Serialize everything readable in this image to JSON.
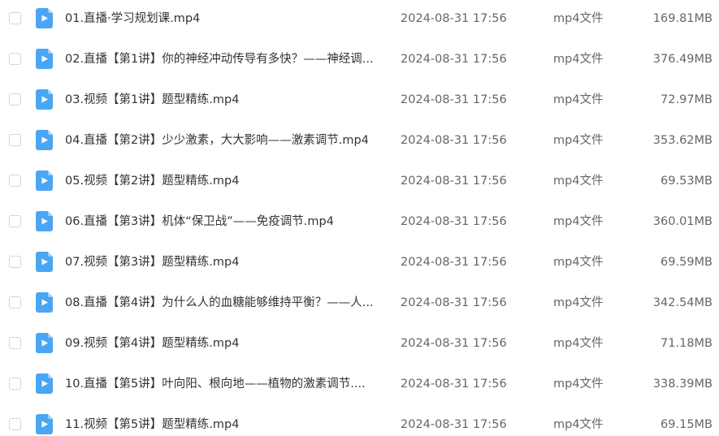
{
  "colors": {
    "icon_blue": "#4aa6f4",
    "icon_fold": "#9fd0fa",
    "checkbox_border": "#d6d6d6",
    "name_text": "#333333",
    "meta_text": "#666666"
  },
  "icon": "video-file-icon",
  "files": [
    {
      "name": "01.直播·学习规划课.mp4",
      "date": "2024-08-31 17:56",
      "type": "mp4文件",
      "size": "169.81MB"
    },
    {
      "name": "02.直播【第1讲】你的神经冲动传导有多快？——神经调...",
      "date": "2024-08-31 17:56",
      "type": "mp4文件",
      "size": "376.49MB"
    },
    {
      "name": "03.视频【第1讲】题型精练.mp4",
      "date": "2024-08-31 17:56",
      "type": "mp4文件",
      "size": "72.97MB"
    },
    {
      "name": "04.直播【第2讲】少少激素，大大影响——激素调节.mp4",
      "date": "2024-08-31 17:56",
      "type": "mp4文件",
      "size": "353.62MB"
    },
    {
      "name": "05.视频【第2讲】题型精练.mp4",
      "date": "2024-08-31 17:56",
      "type": "mp4文件",
      "size": "69.53MB"
    },
    {
      "name": "06.直播【第3讲】机体“保卫战”——免疫调节.mp4",
      "date": "2024-08-31 17:56",
      "type": "mp4文件",
      "size": "360.01MB"
    },
    {
      "name": "07.视频【第3讲】题型精练.mp4",
      "date": "2024-08-31 17:56",
      "type": "mp4文件",
      "size": "69.59MB"
    },
    {
      "name": "08.直播【第4讲】为什么人的血糖能够维持平衡？——人...",
      "date": "2024-08-31 17:56",
      "type": "mp4文件",
      "size": "342.54MB"
    },
    {
      "name": "09.视频【第4讲】题型精练.mp4",
      "date": "2024-08-31 17:56",
      "type": "mp4文件",
      "size": "71.18MB"
    },
    {
      "name": "10.直播【第5讲】叶向阳、根向地——植物的激素调节....",
      "date": "2024-08-31 17:56",
      "type": "mp4文件",
      "size": "338.39MB"
    },
    {
      "name": "11.视频【第5讲】题型精练.mp4",
      "date": "2024-08-31 17:56",
      "type": "mp4文件",
      "size": "69.15MB"
    }
  ]
}
